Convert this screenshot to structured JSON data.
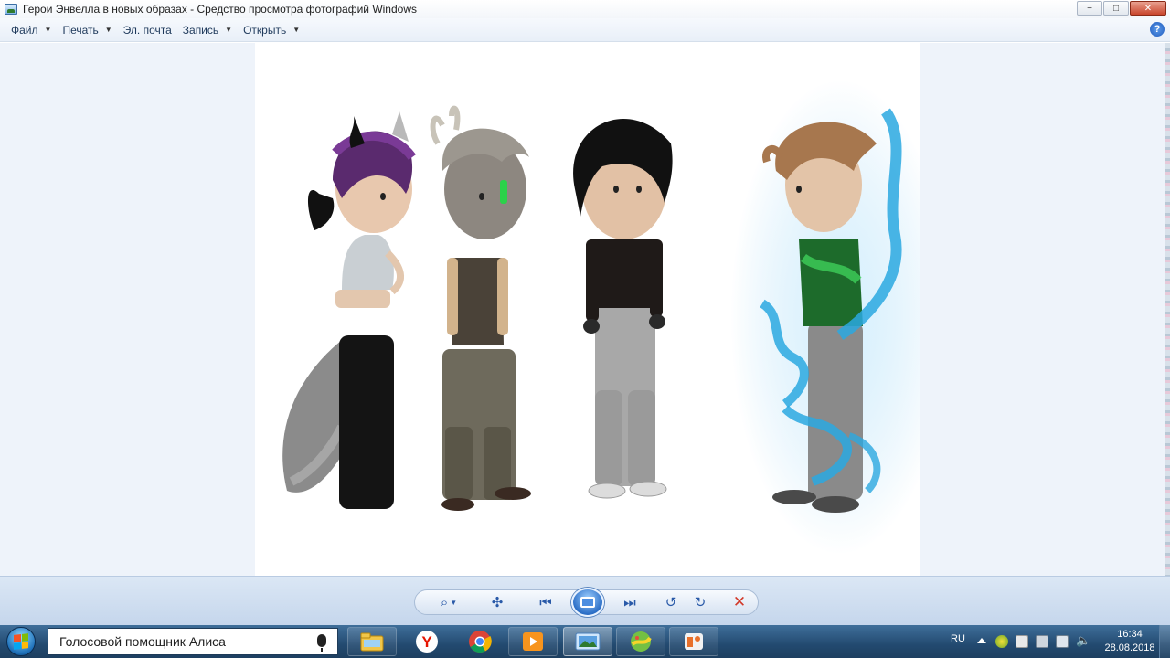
{
  "window": {
    "title": "Герои Энвелла в новых образах - Средство просмотра фотографий Windows",
    "controls": {
      "minimize": "−",
      "maximize": "□",
      "close": "✕"
    }
  },
  "menu": {
    "items": [
      {
        "label": "Файл",
        "has_dropdown": true
      },
      {
        "label": "Печать",
        "has_dropdown": true
      },
      {
        "label": "Эл. почта",
        "has_dropdown": false
      },
      {
        "label": "Запись",
        "has_dropdown": true
      },
      {
        "label": "Открыть",
        "has_dropdown": true
      }
    ],
    "help": "?"
  },
  "controls": {
    "zoom": "⌕",
    "fit": "✣",
    "previous": "⏮",
    "next": "⏭",
    "rotate_left": "↺",
    "rotate_right": "↻",
    "delete": "✕"
  },
  "taskbar": {
    "search_placeholder": "Голосовой помощник Алиса",
    "apps": [
      {
        "name": "explorer-icon"
      },
      {
        "name": "yandex-browser-icon"
      },
      {
        "name": "chrome-icon"
      },
      {
        "name": "media-player-icon"
      },
      {
        "name": "photo-viewer-icon"
      },
      {
        "name": "paint-icon"
      },
      {
        "name": "office-icon"
      }
    ],
    "language": "RU",
    "time": "16:34",
    "date": "28.08.2018"
  },
  "colors": {
    "accent": "#2c6fc7",
    "taskbar": "#234a70",
    "viewer_background": "#eef3fa",
    "delete": "#d23a2a"
  }
}
